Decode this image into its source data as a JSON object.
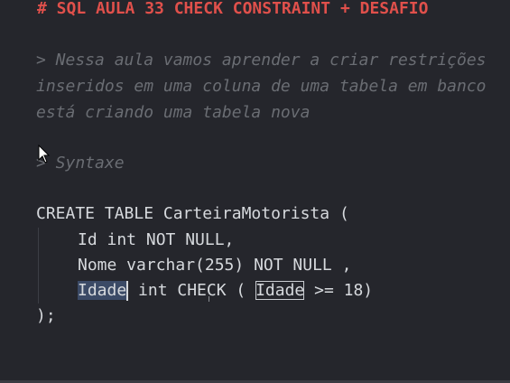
{
  "editor": {
    "heading": "# SQL AULA 33 CHECK CONSTRAINT + DESAFIO",
    "comment_lines": [
      "> Nessa aula vamos aprender a criar restrições",
      "inseridos em uma coluna de uma tabela em banco",
      "está criando uma tabela nova"
    ],
    "syntax_label": "> Syntaxe",
    "code": {
      "line1": "CREATE TABLE CarteiraMotorista (",
      "line2": "Id int NOT NULL,",
      "line3": "Nome varchar(255) NOT NULL ,",
      "line4_selected": "Idade",
      "line4_mid": " int CHECK ( ",
      "line4_boxed": "Idade",
      "line4_end": " >= 18)",
      "line5": ");"
    }
  },
  "colors": {
    "background": "#25262c",
    "heading": "#e0504b",
    "comment": "#6a6d73",
    "code": "#d6d9dd",
    "selection": "#3b4a66"
  },
  "icons": {
    "pointer": "mouse-pointer-icon"
  }
}
